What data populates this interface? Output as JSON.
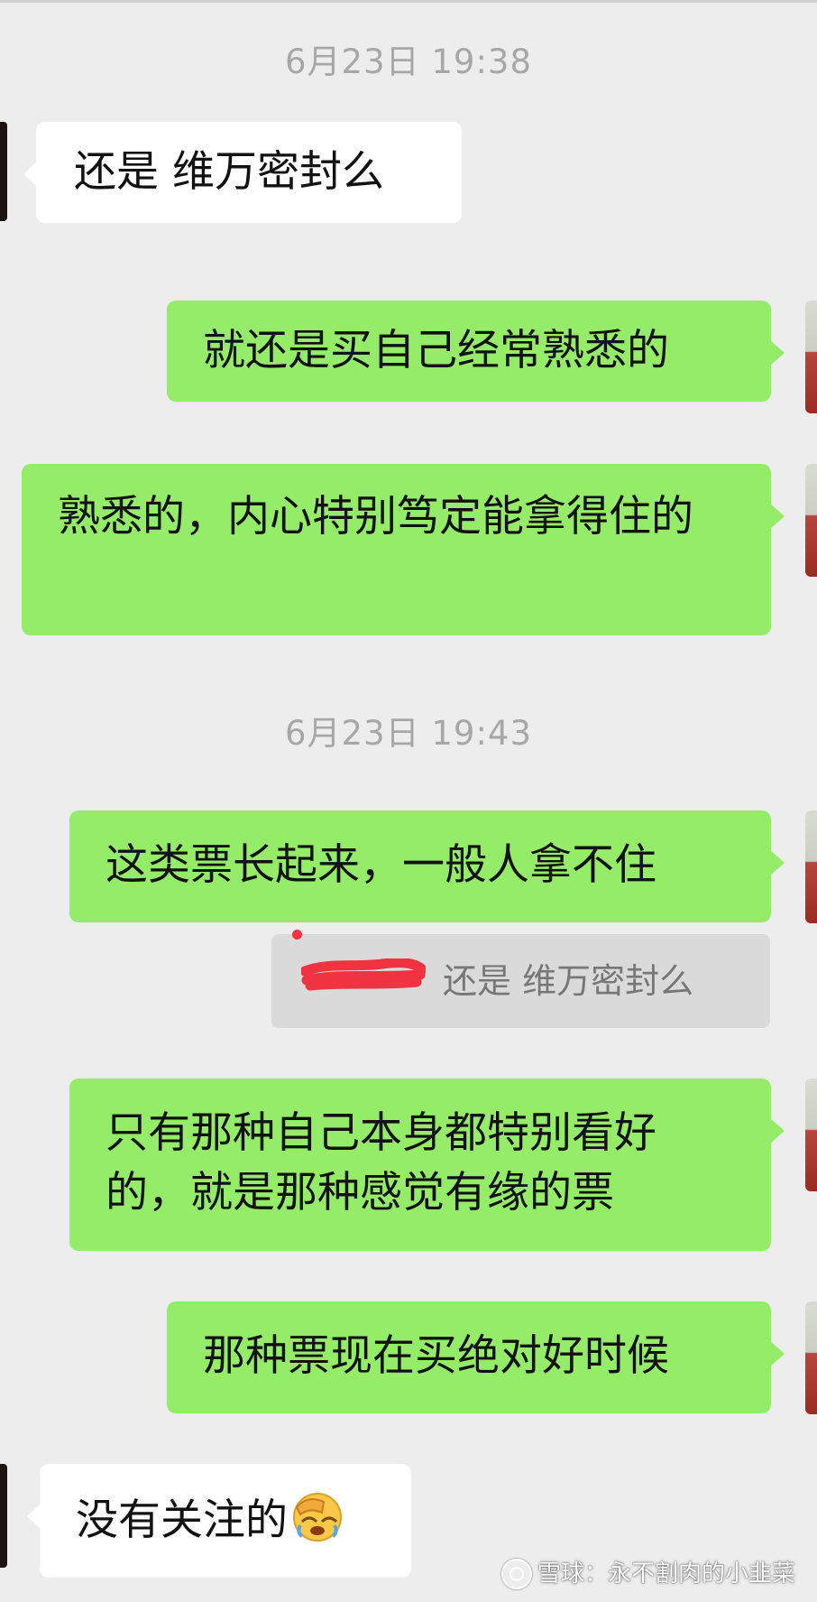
{
  "timestamps": [
    "6月23日 19:38",
    "6月23日 19:43"
  ],
  "messages": [
    {
      "side": "left",
      "text": "还是 维万密封么"
    },
    {
      "side": "right",
      "text": "就还是买自己经常熟悉的"
    },
    {
      "side": "right",
      "text": "熟悉的，内心特别笃定能拿得住的"
    },
    {
      "side": "right",
      "text": "这类票长起来，一般人拿不住"
    },
    {
      "side": "right",
      "text": "只有那种自己本身都特别看好的，就是那种感觉有缘的票"
    },
    {
      "side": "right",
      "text": "那种票现在买绝对好时候"
    },
    {
      "side": "left",
      "text": "没有关注的",
      "emoji": "facepalm-emoji"
    }
  ],
  "quote": {
    "text": "还是 维万密封么",
    "redacted_name": true
  },
  "watermark": {
    "text": "雪球：永不割肉的小韭菜",
    "icon": "xueqiu-logo-icon"
  },
  "colors": {
    "background": "#ededed",
    "outgoing": "#95ec69",
    "incoming": "#ffffff",
    "timestamp": "#a7a7a7"
  }
}
